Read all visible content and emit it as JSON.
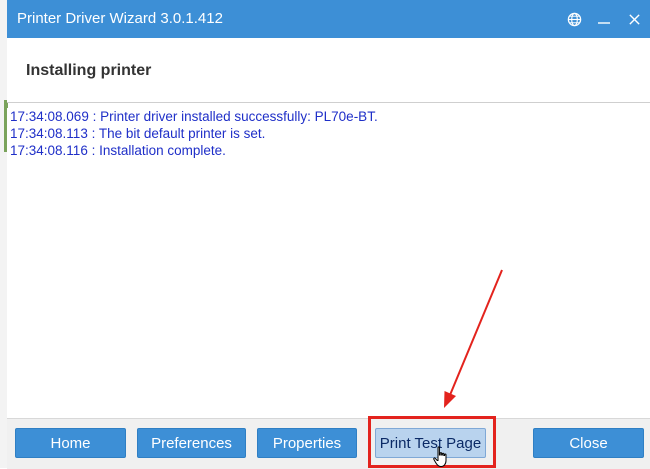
{
  "window": {
    "title": "Printer Driver Wizard  3.0.1.412"
  },
  "titlebar_icons": {
    "language": "globe-icon",
    "minimize": "minimize-icon",
    "close": "close-icon"
  },
  "header": {
    "title": "Installing printer"
  },
  "log": {
    "lines": [
      "17:34:08.069 : Printer driver installed successfully: PL70e-BT.",
      "17:34:08.113 : The bit default printer is set.",
      "17:34:08.116 : Installation complete."
    ]
  },
  "footer": {
    "home_label": "Home",
    "preferences_label": "Preferences",
    "properties_label": "Properties",
    "print_test_label": "Print Test Page",
    "close_label": "Close"
  },
  "colors": {
    "titlebar": "#3d8fd6",
    "button": "#3d8fd6",
    "log_text": "#1f2fc8",
    "annotation": "#e3231d"
  }
}
